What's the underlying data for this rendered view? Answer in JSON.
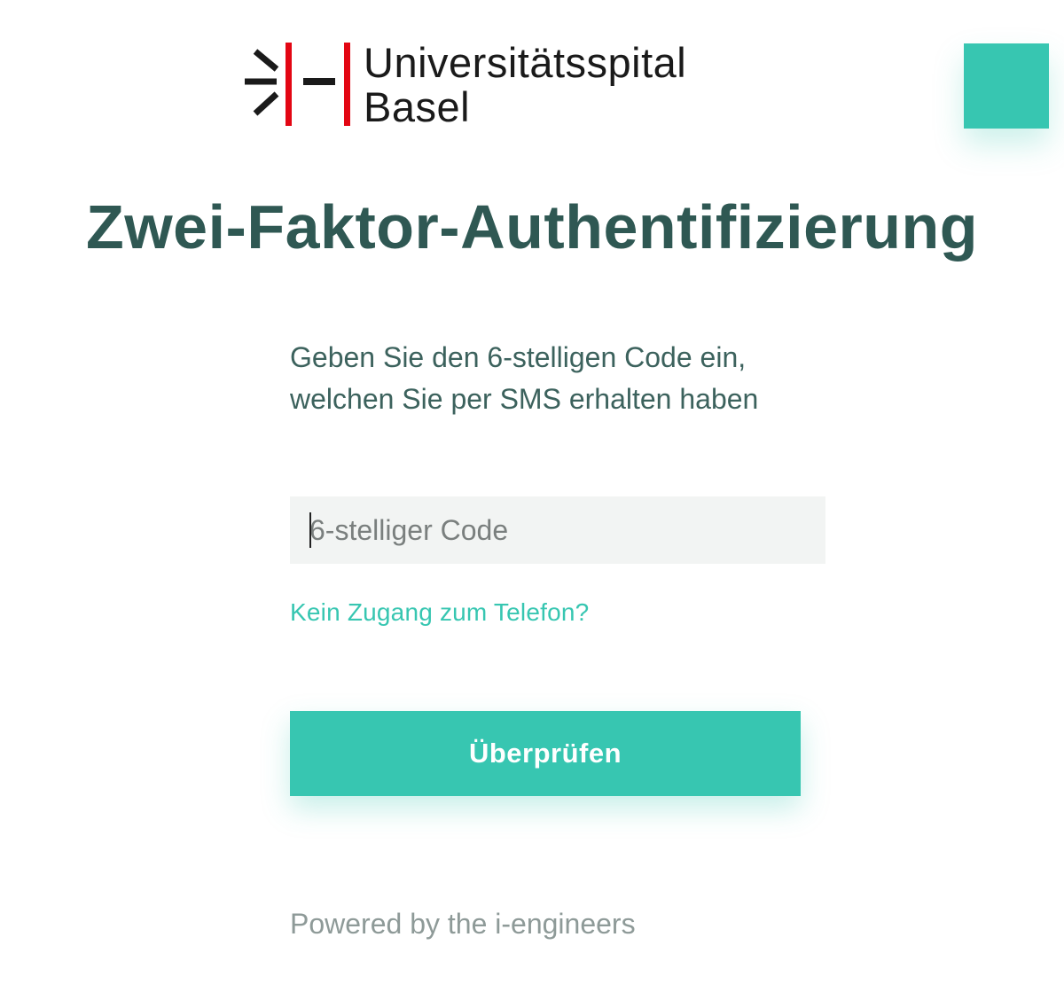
{
  "logo": {
    "line1": "Universitätsspital",
    "line2": "Basel"
  },
  "menu": {
    "icon": "menu-square-icon",
    "color": "#37c6b1"
  },
  "title": "Zwei-Faktor-Authentifizierung",
  "form": {
    "instruction": "Geben Sie den 6-stelligen Code ein, welchen Sie per SMS erhalten haben",
    "code_input": {
      "placeholder": "6-stelliger Code",
      "value": ""
    },
    "no_phone_link": "Kein Zugang zum Telefon?",
    "verify_button": "Überprüfen"
  },
  "footer": {
    "powered_by": "Powered by the i-engineers"
  },
  "colors": {
    "accent": "#37c6b1",
    "title": "#2f5853",
    "logo_red": "#e30613",
    "logo_dark": "#1a1a1a"
  }
}
